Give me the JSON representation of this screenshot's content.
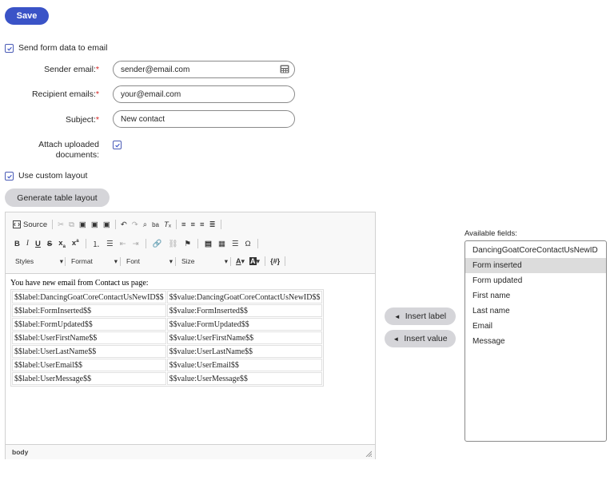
{
  "save_label": "Save",
  "send_form": {
    "label": "Send form data to email",
    "checked": true
  },
  "fields": {
    "sender_label": "Sender email:",
    "sender_value": "sender@email.com",
    "recipient_label": "Recipient emails:",
    "recipient_value": "your@email.com",
    "subject_label": "Subject:",
    "subject_value": "New contact",
    "attach_label_1": "Attach uploaded",
    "attach_label_2": "documents:",
    "required_mark": "*"
  },
  "custom_layout": {
    "label": "Use custom layout",
    "checked": true
  },
  "generate_label": "Generate table layout",
  "toolbar": {
    "source": "Source",
    "styles": "Styles",
    "format": "Format",
    "font": "Font",
    "size": "Size",
    "var_label": "{#}"
  },
  "editor": {
    "intro": "You have new email from Contact us page:",
    "rows": [
      [
        "$$label:DancingGoatCoreContactUsNewID$$",
        "$$value:DancingGoatCoreContactUsNewID$$"
      ],
      [
        "$$label:FormInserted$$",
        "$$value:FormInserted$$"
      ],
      [
        "$$label:FormUpdated$$",
        "$$value:FormUpdated$$"
      ],
      [
        "$$label:UserFirstName$$",
        "$$value:UserFirstName$$"
      ],
      [
        "$$label:UserLastName$$",
        "$$value:UserLastName$$"
      ],
      [
        "$$label:UserEmail$$",
        "$$value:UserEmail$$"
      ],
      [
        "$$label:UserMessage$$",
        "$$value:UserMessage$$"
      ]
    ],
    "status": "body"
  },
  "insert_label": "Insert label",
  "insert_value": "Insert value",
  "available": {
    "title": "Available fields:",
    "items": [
      "DancingGoatCoreContactUsNewID",
      "Form inserted",
      "Form updated",
      "First name",
      "Last name",
      "Email",
      "Message"
    ],
    "selected_index": 1
  },
  "colors": {
    "primary": "#3a53c7",
    "required": "#d32020",
    "selection": "#dcdcdc"
  }
}
